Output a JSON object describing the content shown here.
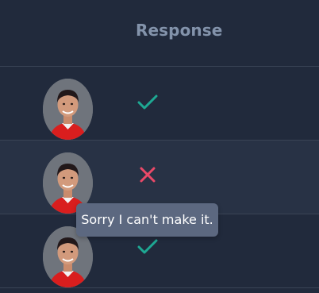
{
  "header": {
    "response_label": "Response"
  },
  "rows": [
    {
      "response": "accepted",
      "icon": "check-icon"
    },
    {
      "response": "declined",
      "icon": "cross-icon"
    },
    {
      "response": "accepted",
      "icon": "check-icon"
    }
  ],
  "tooltip": {
    "text": "Sorry I can't make it."
  },
  "colors": {
    "background": "#212a3c",
    "row_alt": "#283245",
    "accept": "#1ea893",
    "decline": "#ea4968",
    "tooltip_bg": "#5c6880",
    "header_text": "#8393ab"
  }
}
